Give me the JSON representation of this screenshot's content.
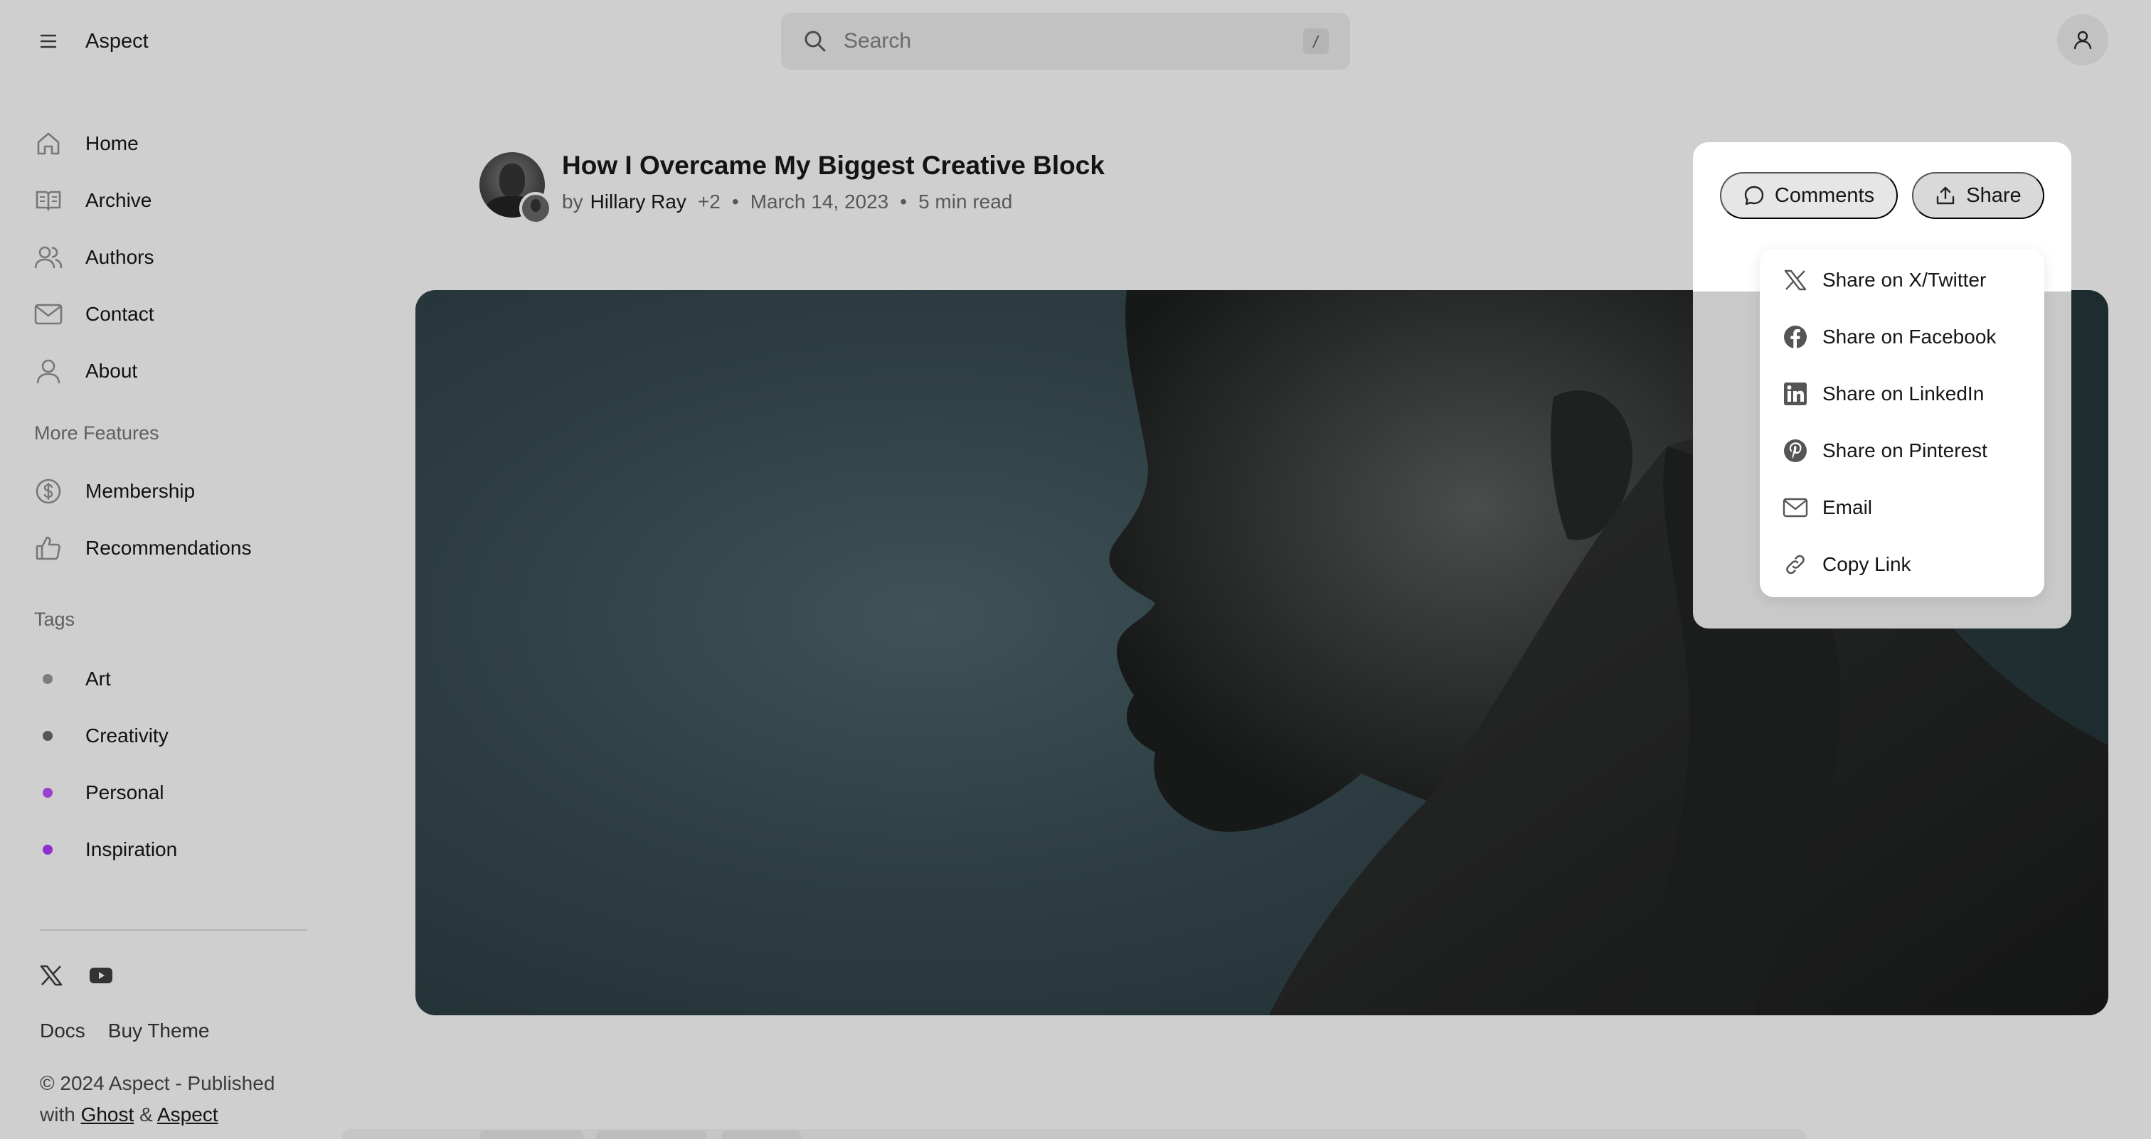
{
  "app": {
    "name": "Aspect"
  },
  "search": {
    "placeholder": "Search",
    "shortcut": "/"
  },
  "sidebar": {
    "nav": [
      {
        "label": "Home",
        "icon": "home-icon"
      },
      {
        "label": "Archive",
        "icon": "book-open-icon"
      },
      {
        "label": "Authors",
        "icon": "users-icon"
      },
      {
        "label": "Contact",
        "icon": "mail-icon"
      },
      {
        "label": "About",
        "icon": "user-icon"
      }
    ],
    "more_heading": "More Features",
    "more": [
      {
        "label": "Membership",
        "icon": "dollar-circle-icon"
      },
      {
        "label": "Recommendations",
        "icon": "thumbs-up-icon"
      }
    ],
    "tags_heading": "Tags",
    "tags": [
      {
        "label": "Art",
        "color": "#7d7d7d"
      },
      {
        "label": "Creativity",
        "color": "#555555"
      },
      {
        "label": "Personal",
        "color": "#9b3fd1"
      },
      {
        "label": "Inspiration",
        "color": "#8e2fd0"
      }
    ],
    "social": [
      "x-twitter-icon",
      "youtube-icon"
    ],
    "footer_links": [
      "Docs",
      "Buy Theme"
    ],
    "copyright_prefix": "© 2024 Aspect - Published with",
    "copyright_link1": "Ghost",
    "copyright_amp": "&",
    "copyright_link2": "Aspect"
  },
  "post": {
    "title": "How I Overcame My Biggest Creative Block",
    "by": "by",
    "author": "Hillary Ray",
    "extra_authors": "+2",
    "date": "March 14, 2023",
    "read_time": "5 min read",
    "separator": "•"
  },
  "actions": {
    "comments_label": "Comments",
    "share_label": "Share"
  },
  "share_menu": [
    {
      "label": "Share on X/Twitter",
      "icon": "x-twitter-icon"
    },
    {
      "label": "Share on Facebook",
      "icon": "facebook-icon"
    },
    {
      "label": "Share on LinkedIn",
      "icon": "linkedin-icon"
    },
    {
      "label": "Share on Pinterest",
      "icon": "pinterest-icon"
    },
    {
      "label": "Email",
      "icon": "mail-icon"
    },
    {
      "label": "Copy Link",
      "icon": "link-icon"
    }
  ]
}
